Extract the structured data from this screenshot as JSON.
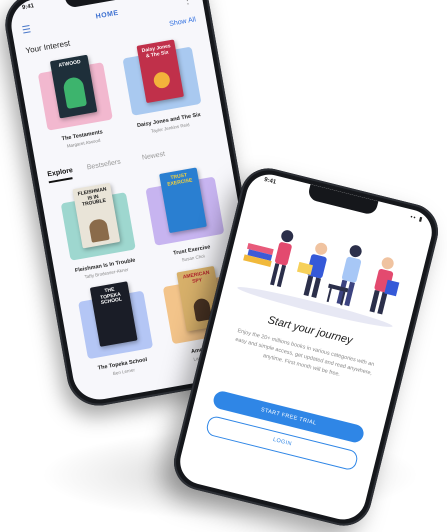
{
  "phone_library": {
    "status": {
      "time": "9:41",
      "sys_icons": "••• ▮"
    },
    "header": {
      "menu_icon": "menu-icon",
      "title": "HOME",
      "more_icon": "more-icon"
    },
    "interest": {
      "heading": "Your Interest",
      "show_all": "Show All",
      "books": [
        {
          "title": "The Testaments",
          "author": "Margaret Atwood",
          "cover_text": "ATWOOD",
          "cover_color": "#1e2f3a",
          "bg_color": "#f2b8cf"
        },
        {
          "title": "Daisy Jones and The Six",
          "author": "Taylor Jenkins Reid",
          "cover_text": "Daisy Jones & The Six",
          "cover_color": "#c0304a",
          "bg_color": "#a9c9f0"
        }
      ]
    },
    "tabs": {
      "items": [
        "Explore",
        "Bestsellers",
        "Newest"
      ],
      "active": "Explore"
    },
    "explore_books": [
      {
        "title": "Fleishman Is In Trouble",
        "author": "Taffy Brodesser-Akner",
        "cover_text": "FLEISHMAN IS IN TROUBLE",
        "cover_color": "#e9e4d8",
        "bg_color": "#9ed7cf"
      },
      {
        "title": "Trust Exercise",
        "author": "Susan Choi",
        "cover_text": "TRUST EXERCISE",
        "cover_color": "#2a7fd1",
        "bg_color": "#c7b4f0"
      },
      {
        "title": "The Topeka School",
        "author": "Ben Lerner",
        "cover_text": "THE TOPEKA SCHOOL",
        "cover_color": "#1a1d27",
        "bg_color": "#b4c6f5"
      },
      {
        "title": "American Spy",
        "author": "Lauren Wilkinson",
        "cover_text": "AMERICAN SPY",
        "cover_color": "#d7b06a",
        "bg_color": "#f3c48a"
      }
    ]
  },
  "phone_onboarding": {
    "status": {
      "time": "9:41",
      "sys_icons": "•• ▮"
    },
    "title": "Start your journey",
    "description": "Enjoy the 20+ millions books in various categories with an easy and simple access, get updated and read anywhere, anytime. First month will be free.",
    "primary_button": "START FREE TRIAL",
    "secondary_button": "LOGIN"
  },
  "colors": {
    "accent": "#2f86e6",
    "phone_frame": "#15171b"
  }
}
